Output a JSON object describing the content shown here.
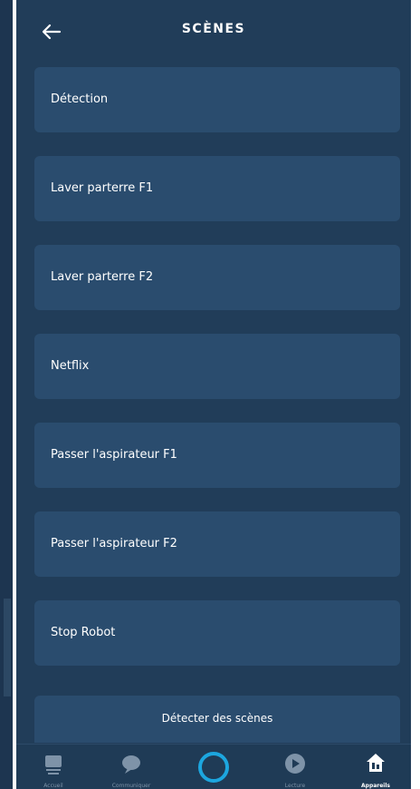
{
  "header": {
    "title": "SCÈNES",
    "back_icon": "arrow-left-icon"
  },
  "scenes": [
    {
      "label": "Détection"
    },
    {
      "label": "Laver parterre F1"
    },
    {
      "label": "Laver parterre F2"
    },
    {
      "label": "Netflix"
    },
    {
      "label": "Passer l'aspirateur F1"
    },
    {
      "label": "Passer l'aspirateur F2"
    },
    {
      "label": "Stop Robot"
    }
  ],
  "detect_button": {
    "label": "Détecter des scènes"
  },
  "bottom_nav": {
    "items": [
      {
        "label": "Accueil",
        "icon": "home-dashboard-icon"
      },
      {
        "label": "Communiquer",
        "icon": "chat-bubble-icon"
      },
      {
        "label": "",
        "icon": "alexa-ring-icon"
      },
      {
        "label": "Lecture",
        "icon": "play-icon"
      },
      {
        "label": "Appareils",
        "icon": "devices-house-icon"
      }
    ],
    "active_index": 4
  },
  "colors": {
    "background": "#213d59",
    "card": "#2a4c6e",
    "accent": "#1ca6df",
    "text": "#ffffff"
  }
}
